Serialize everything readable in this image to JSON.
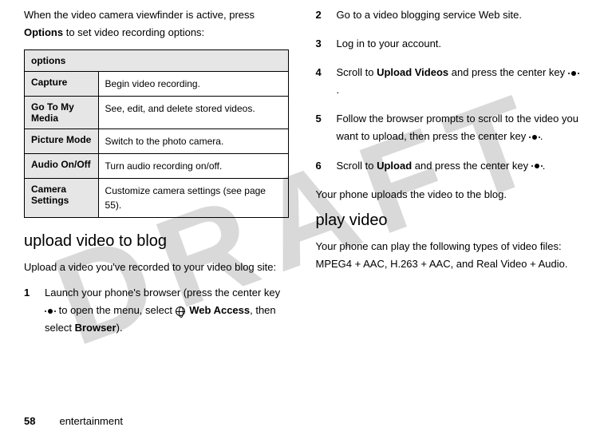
{
  "watermark": "DRAFT",
  "left": {
    "intro_pre": "When the video camera viewfinder is active, press ",
    "intro_bold": "Options",
    "intro_post": " to set video recording options:",
    "table_header": "options",
    "table": [
      {
        "label": "Capture",
        "desc": "Begin video recording."
      },
      {
        "label": "Go To My Media",
        "desc": "See, edit, and delete stored videos."
      },
      {
        "label": "Picture Mode",
        "desc": "Switch to the photo camera."
      },
      {
        "label": "Audio On/Off",
        "desc": "Turn audio recording on/off."
      },
      {
        "label": "Camera Settings",
        "desc": "Customize camera settings (see page 55)."
      }
    ],
    "heading_upload": "upload video to blog",
    "upload_intro": "Upload a video you've recorded to your video blog site:",
    "step1": {
      "num": "1",
      "pre": "Launch your phone's browser (press the center key ",
      "mid1": " to open the menu, select ",
      "web_access": "Web Access",
      "mid2": ", then select ",
      "browser": "Browser",
      "post": ")."
    }
  },
  "right": {
    "step2": {
      "num": "2",
      "text": "Go to a video blogging service Web site."
    },
    "step3": {
      "num": "3",
      "text": "Log in to your account."
    },
    "step4": {
      "num": "4",
      "pre": "Scroll to ",
      "bold": "Upload Videos",
      "mid": " and press the center key ",
      "post": "."
    },
    "step5": {
      "num": "5",
      "pre": "Follow the browser prompts to scroll to the video you want to upload, then press the center key ",
      "post": "."
    },
    "step6": {
      "num": "6",
      "pre": "Scroll to ",
      "bold": "Upload",
      "mid": " and press the center key ",
      "post": "."
    },
    "upload_done": "Your phone uploads the video to the blog.",
    "heading_play": "play video",
    "play_text": "Your phone can play the following types of video files: MPEG4 + AAC, H.263 + AAC, and Real Video + Audio."
  },
  "footer": {
    "page": "58",
    "section": "entertainment"
  }
}
